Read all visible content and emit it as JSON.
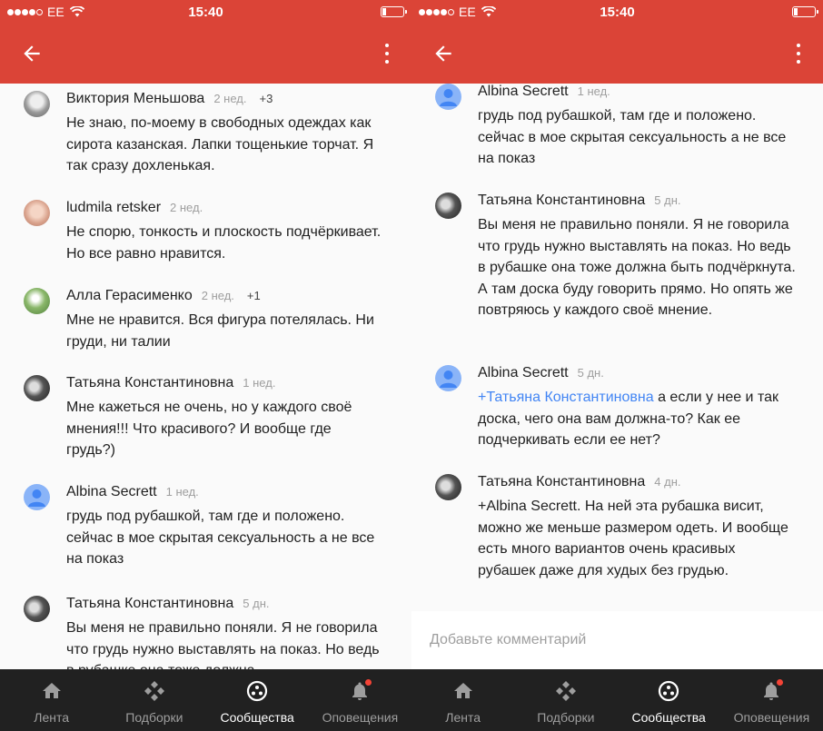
{
  "status": {
    "carrier": "EE",
    "time": "15:40"
  },
  "colors": {
    "header": "#db4437",
    "nav_bg": "#212121",
    "mention": "#4285f4",
    "badge": "#f44336"
  },
  "left": {
    "comments": [
      {
        "name": "Виктория Меньшова",
        "time": "2 нед.",
        "plus": "+3",
        "text": "Не знаю, по-моему в свободных одеждах как сирота казанская. Лапки тощенькие торчат. Я так сразу дохленькая."
      },
      {
        "name": "ludmila retsker",
        "time": "2 нед.",
        "text": "Не спорю, тонкость и плоскость подчёркивает. Но все равно нравится."
      },
      {
        "name": "Алла Герасименко",
        "time": "2 нед.",
        "plus": "+1",
        "text": "Мне не нравится. Вся фигура потелялась. Ни груди, ни талии"
      },
      {
        "name": "Татьяна Константиновна",
        "time": "1 нед.",
        "text": "Мне кажеться не очень, но у каждого своё мнения!!! Что красивого?  И вообще где грудь?)"
      },
      {
        "name": "Albina Secrett",
        "time": "1 нед.",
        "text": "грудь под рубашкой, там где и положено. сейчас в мое скрытая сексуальность а не все на показ"
      },
      {
        "name": "Татьяна Константиновна",
        "time": "5 дн.",
        "text": "Вы меня не правильно поняли. Я не говорила что грудь нужно выставлять на показ. Но ведь в рубашке она тоже должна"
      }
    ]
  },
  "right": {
    "comments": [
      {
        "name": "Albina Secrett",
        "time": "1 нед.",
        "text": "грудь под рубашкой, там где и положено. сейчас в мое скрытая сексуальность а не все на показ"
      },
      {
        "name": "Татьяна Константиновна",
        "time": "5 дн.",
        "text": "Вы меня не правильно поняли. Я не говорила что грудь нужно выставлять на показ. Но ведь в рубашке она тоже должна быть подчёркнута. А там доска буду говорить прямо. Но опять же повтряюсь у каждого своё мнение."
      },
      {
        "name": "Albina Secrett",
        "time": "5 дн.",
        "mention": "+Татьяна Константиновна",
        "text": " а если у нее и так доска, чего она вам должна-то? Как ее подчеркивать если ее нет?"
      },
      {
        "name": "Татьяна Константиновна",
        "time": "4 дн.",
        "text": "+Albina Secrett. На ней эта рубашка висит, можно же меньше размером одеть. И вообще есть много вариантов очень красивых рубашек даже для худых без грудью."
      }
    ],
    "composer_placeholder": "Добавьте комментарий"
  },
  "nav": {
    "items": [
      {
        "label": "Лента",
        "icon": "home-icon"
      },
      {
        "label": "Подборки",
        "icon": "collections-icon"
      },
      {
        "label": "Сообщества",
        "icon": "communities-icon"
      },
      {
        "label": "Оповещения",
        "icon": "bell-icon"
      }
    ]
  }
}
